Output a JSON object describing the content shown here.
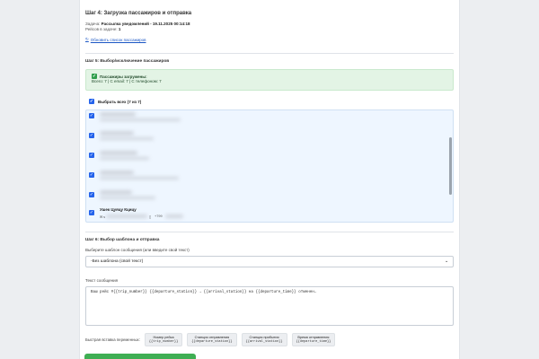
{
  "step4": {
    "title": "Шаг 4: Загрузка пассажиров и отправка",
    "task_label": "Задача:",
    "task_value": "Рассылка уведомлений - 19.11.2025 00:14:18",
    "trips_label": "Рейсов в задаче:",
    "trips_value": "1",
    "refresh_link": "Обновить список пассажиров"
  },
  "step5": {
    "title": "Шаг 5: Выбор/исключение пассажиров",
    "success_title": "Пассажиры загружены:",
    "success_body": "Всего: 7 | С email: 7 | С телефоном: 7",
    "select_all": "Выбрать всех (7 из 7)",
    "visible_passenger": {
      "name": "Ушек Цуяцу Кцицу",
      "email_prefix": "✉ s",
      "phone_prefix": "+799"
    }
  },
  "step6": {
    "title": "Шаг 6: Выбор шаблона и отправка",
    "template_label": "Выберите шаблон сообщения (или введите свой текст)",
    "template_value": "-Без шаблона (свой текст)",
    "message_label": "Текст сообщения",
    "message_value": "Ваш рейс #{{trip_number}} {{departure_station}} → {{arrival_station}} на {{departure_time}} отменен…",
    "quick_insert_label": "Быстрая вставка переменных:",
    "variables": [
      {
        "title": "Номер рейса",
        "code": "{{trip_number}}"
      },
      {
        "title": "Станция отправления",
        "code": "{{departure_station}}"
      },
      {
        "title": "Станция прибытия",
        "code": "{{arrival_station}}"
      },
      {
        "title": "Время отправления",
        "code": "{{departure_time}}"
      }
    ]
  },
  "colors": {
    "accent": "#2563eb",
    "success_bg": "#e3f4e5",
    "send_button": "#3fae53"
  }
}
